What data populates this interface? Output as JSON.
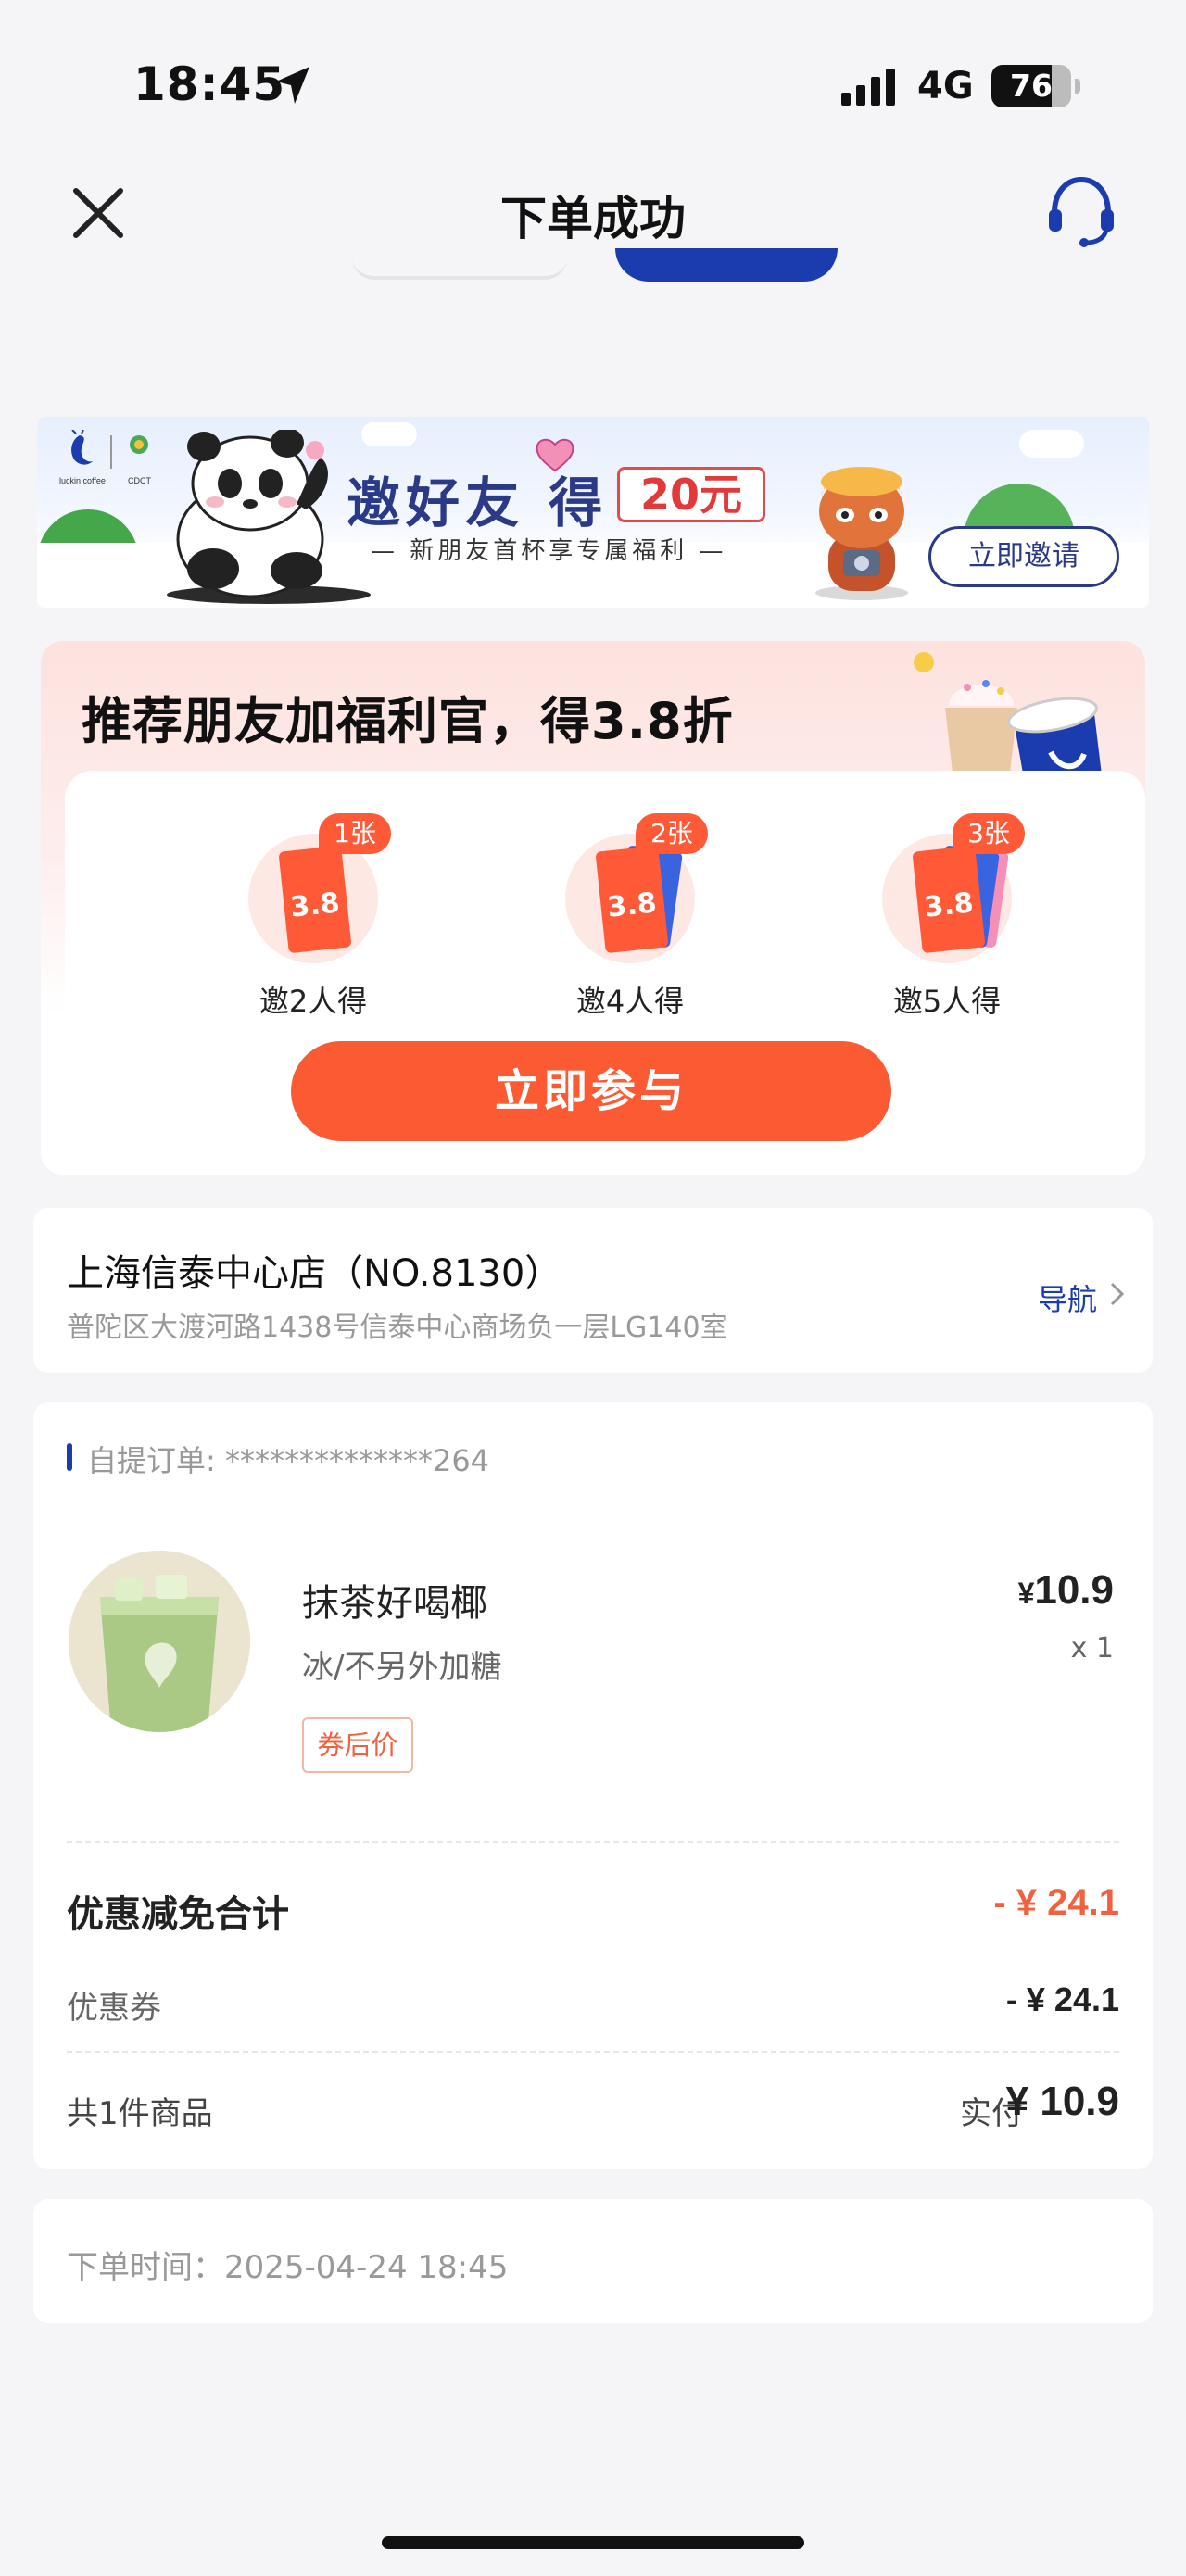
{
  "status_bar": {
    "time": "18:45",
    "network": "4G",
    "battery": "76",
    "battery_level": 0.76
  },
  "header": {
    "title": "下单成功",
    "close_icon": "close-icon",
    "service_icon": "headset-icon"
  },
  "invite_banner": {
    "title": "邀好友 得",
    "amount": "20元",
    "subtitle": "— 新朋友首杯享专属福利 —",
    "button": "立即邀请",
    "logo_text_1": "luckin coffee",
    "logo_text_2": "CDCT"
  },
  "recommend": {
    "title": "推荐朋友加福利官，得3.8折",
    "coupons": [
      {
        "badge": "1张",
        "value": "3.8",
        "label": "邀2人得"
      },
      {
        "badge": "2张",
        "value": "3.8",
        "label": "邀4人得"
      },
      {
        "badge": "3张",
        "value": "3.8",
        "label": "邀5人得"
      }
    ],
    "join_button": "立即参与"
  },
  "store": {
    "name": "上海信泰中心店（NO.8130）",
    "address": "普陀区大渡河路1438号信泰中心商场负一层LG140室",
    "nav_label": "导航"
  },
  "order": {
    "order_no": "自提订单: **************264",
    "product_name": "抹茶好喝椰",
    "product_spec": "冰/不另外加糖",
    "tag": "券后价",
    "price_symbol": "¥",
    "price": "10.9",
    "qty": "x 1",
    "discount_total_label": "优惠减免合计",
    "discount_total_value": "- ¥ 24.1",
    "coupon_label": "优惠券",
    "coupon_value": "- ¥ 24.1",
    "count_label": "共1件商品",
    "paid_label": "实付",
    "paid_value": "¥ 10.9"
  },
  "order_time": "下单时间：2025-04-24 18:45",
  "colors": {
    "accent_blue": "#1a3cae",
    "accent_orange": "#fb5a33",
    "discount_red": "#f0623f"
  }
}
